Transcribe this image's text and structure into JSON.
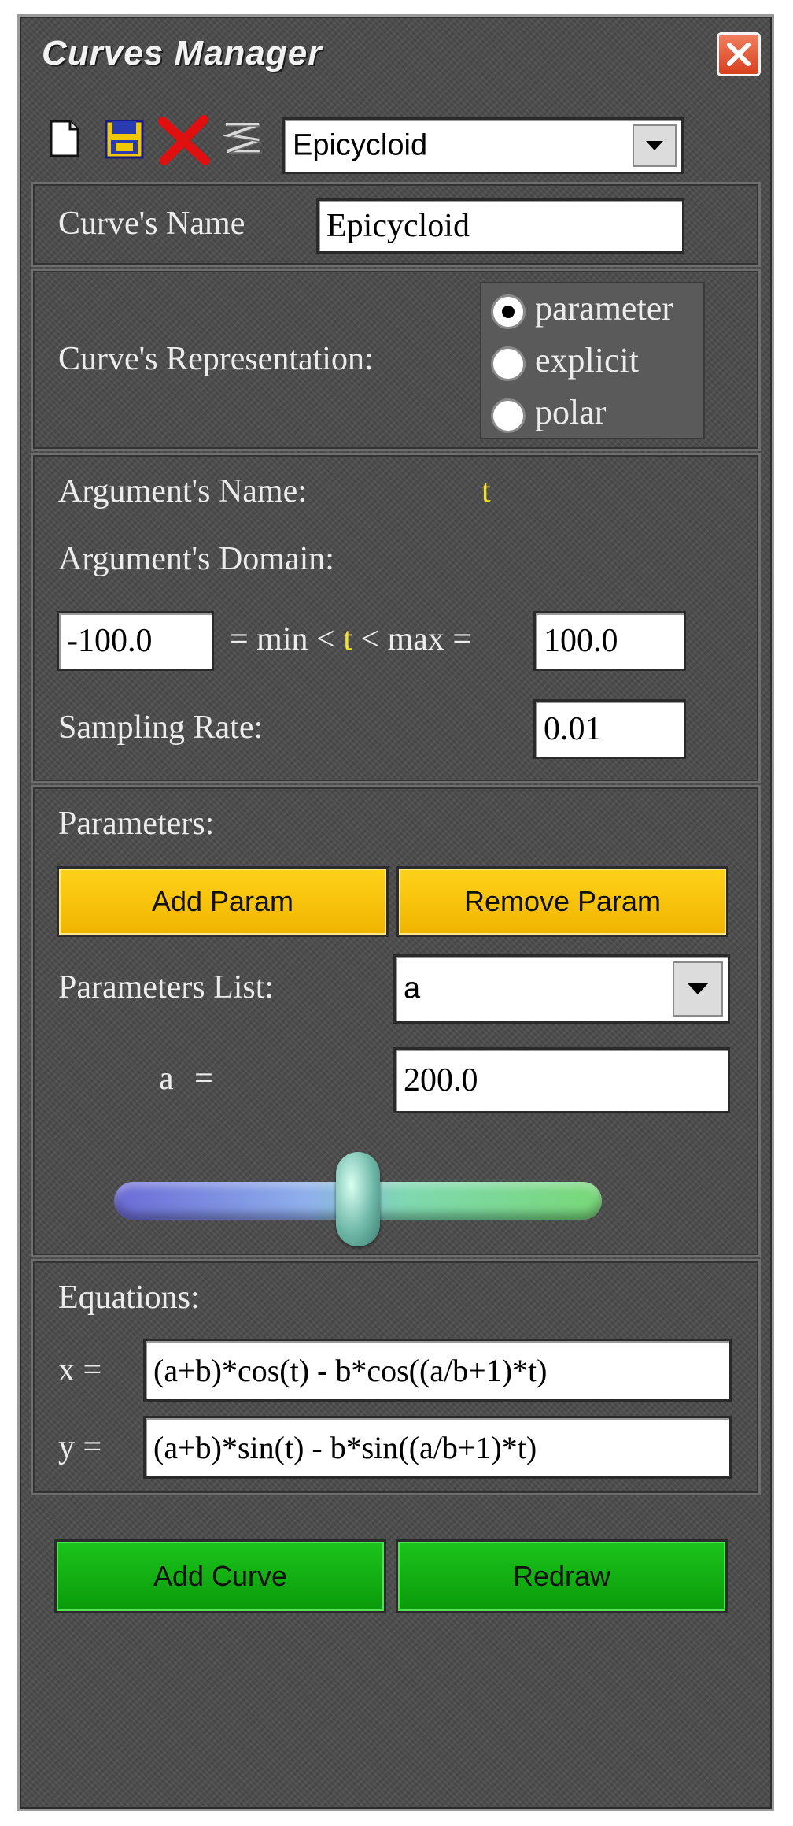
{
  "window": {
    "title": "Curves Manager"
  },
  "toolbar": {
    "icons": [
      "new-file-icon",
      "save-icon",
      "delete-icon",
      "curve-icon"
    ],
    "curve_select_value": "Epicycloid"
  },
  "curve_name": {
    "label": "Curve's Name",
    "value": "Epicycloid"
  },
  "representation": {
    "label": "Curve's Representation:",
    "options": [
      "parameter",
      "explicit",
      "polar"
    ],
    "selected": "parameter"
  },
  "argument": {
    "name_label": "Argument's Name:",
    "name_value": "t",
    "domain_label": "Argument's Domain:",
    "min_value": "-100.0",
    "min_text": "= min <",
    "var": "t",
    "max_text": "< max =",
    "max_value": "100.0",
    "sampling_label": "Sampling Rate:",
    "sampling_value": "0.01"
  },
  "parameters": {
    "label": "Parameters:",
    "add_label": "Add Param",
    "remove_label": "Remove Param",
    "list_label": "Parameters List:",
    "list_value": "a",
    "current_name": "a",
    "eq_sign": "=",
    "current_value": "200.0",
    "slider_fraction": 0.5
  },
  "equations": {
    "label": "Equations:",
    "x_label": "x =",
    "x_value": "(a+b)*cos(t) - b*cos((a/b+1)*t)",
    "y_label": "y =",
    "y_value": "(a+b)*sin(t) - b*sin((a/b+1)*t)"
  },
  "actions": {
    "add_curve_label": "Add Curve",
    "redraw_label": "Redraw"
  },
  "colors": {
    "accent_yellow": "#ffd21a",
    "accent_green": "#1cc41c",
    "arg_highlight": "#f2e02a",
    "close_red": "#d8401e"
  }
}
